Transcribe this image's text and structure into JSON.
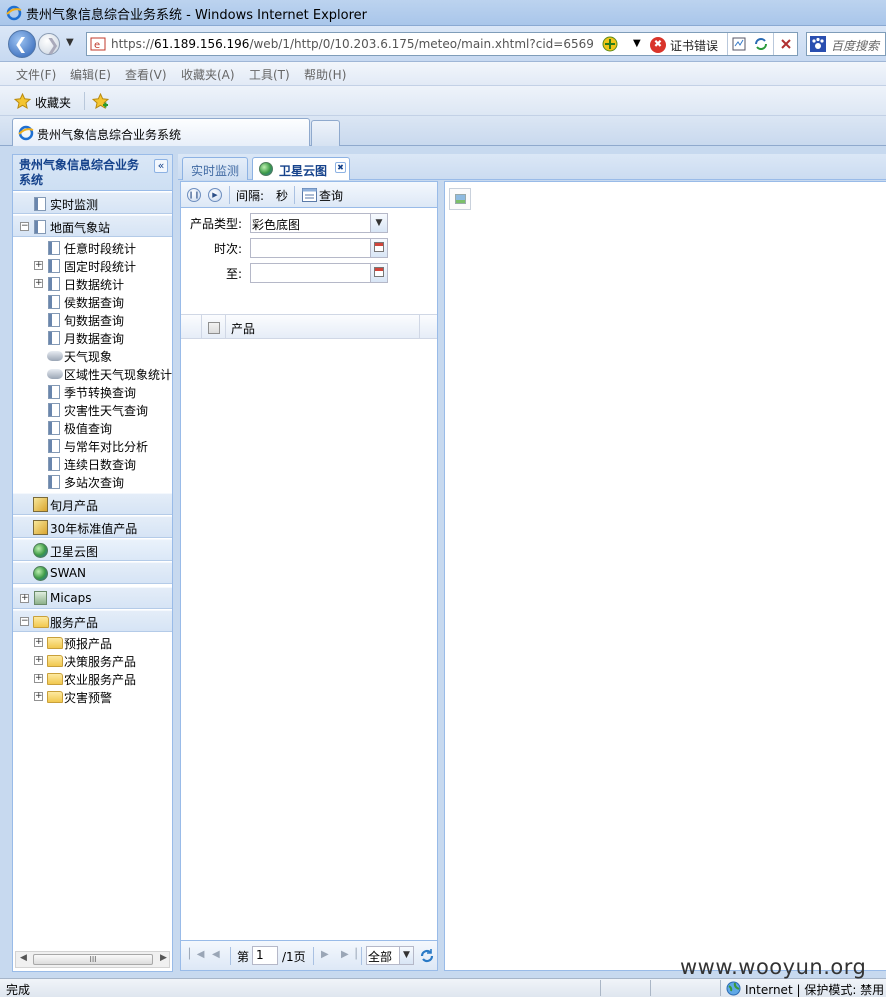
{
  "window": {
    "title": "贵州气象信息综合业务系统 - Windows Internet Explorer"
  },
  "address": {
    "url_prefix": "https://",
    "url_host": "61.189.156.196",
    "url_path": "/web/1/http/0/10.203.6.175/meteo/main.xhtml?cid=6569",
    "cert_error": "证书错误",
    "search_placeholder": "百度搜索"
  },
  "menu": [
    "文件(F)",
    "编辑(E)",
    "查看(V)",
    "收藏夹(A)",
    "工具(T)",
    "帮助(H)"
  ],
  "favorites": {
    "label": "收藏夹"
  },
  "browser_tab": {
    "title": "贵州气象信息综合业务系统"
  },
  "sidebar": {
    "title": "贵州气象信息综合业务系统",
    "collapse_glyph": "«",
    "sections": [
      {
        "label": "实时监测"
      },
      {
        "label": "地面气象站",
        "expanded": true
      },
      {
        "label": "旬月产品"
      },
      {
        "label": "30年标准值产品"
      },
      {
        "label": "卫星云图",
        "selected": true
      },
      {
        "label": "SWAN"
      },
      {
        "label": "Micaps"
      },
      {
        "label": "服务产品",
        "expanded": true
      }
    ],
    "station_items": [
      "任意时段统计",
      "固定时段统计",
      "日数据统计",
      "侯数据查询",
      "旬数据查询",
      "月数据查询",
      "天气现象",
      "区域性天气现象统计",
      "季节转换查询",
      "灾害性天气查询",
      "极值查询",
      "与常年对比分析",
      "连续日数查询",
      "多站次查询"
    ],
    "service_items": [
      "预报产品",
      "决策服务产品",
      "农业服务产品",
      "灾害预警"
    ]
  },
  "content_tabs": [
    {
      "label": "实时监测",
      "active": false
    },
    {
      "label": "卫星云图",
      "active": true,
      "closable": true
    }
  ],
  "query": {
    "interval_label": "间隔:",
    "interval_unit": "秒",
    "query_button": "查询",
    "product_type_label": "产品类型:",
    "product_type_value": "彩色底图",
    "time_label": "时次:",
    "time_value": "",
    "to_label": "至:",
    "to_value": "",
    "grid_header": "产品",
    "pager": {
      "prefix": "第",
      "page": "1",
      "suffix": "/1页",
      "size": "全部"
    }
  },
  "status": {
    "left": "完成",
    "zone": "Internet | 保护模式: 禁用"
  },
  "watermark": "www.wooyun.org"
}
